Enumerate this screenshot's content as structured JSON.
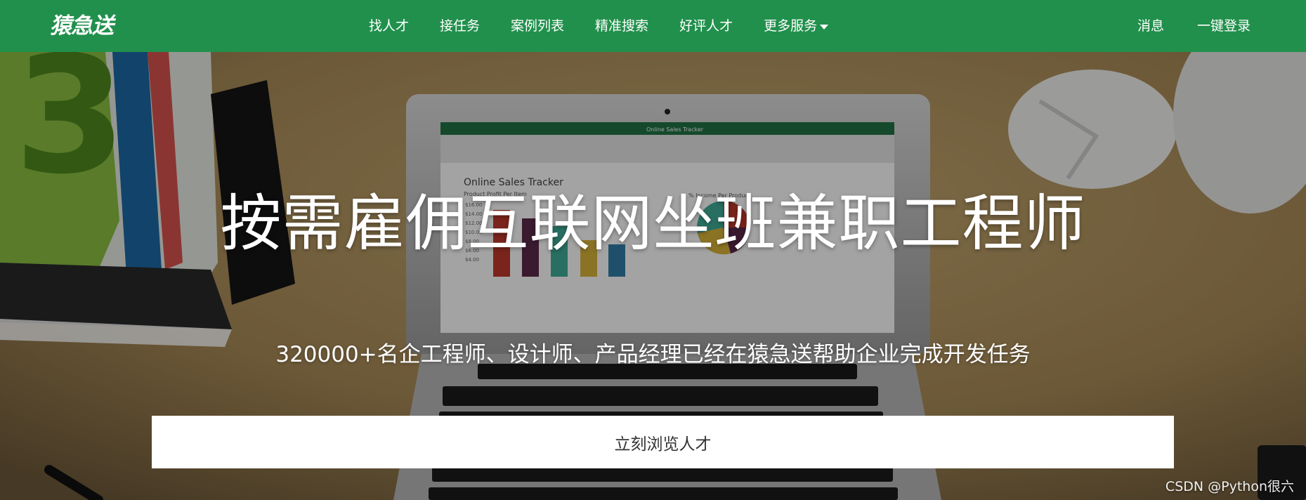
{
  "navbar": {
    "brand": "猿急送",
    "links": [
      "找人才",
      "接任务",
      "案例列表",
      "精准搜索",
      "好评人才",
      "更多服务"
    ],
    "right_links": [
      "消息",
      "一键登录"
    ]
  },
  "hero": {
    "headline": "按需雇佣互联网坐班兼职工程师",
    "subline": "320000+名企工程师、设计师、产品经理已经在猿急送帮助企业完成开发任务",
    "cta_label": "立刻浏览人才"
  },
  "laptop_screen": {
    "title": "Online Sales Tracker",
    "window_title": "Online Sales Tracker",
    "left_chart_title": "Product Profit Per Item",
    "right_chart_title": "% Income Per Product",
    "y_ticks": [
      "$16.00",
      "$14.00",
      "$12.00",
      "$10.00",
      "$8.00",
      "$6.00",
      "$4.00"
    ]
  },
  "watermark": "CSDN @Python很六",
  "colors": {
    "nav_green": "#21904c",
    "cta_bg": "#ffffff"
  }
}
